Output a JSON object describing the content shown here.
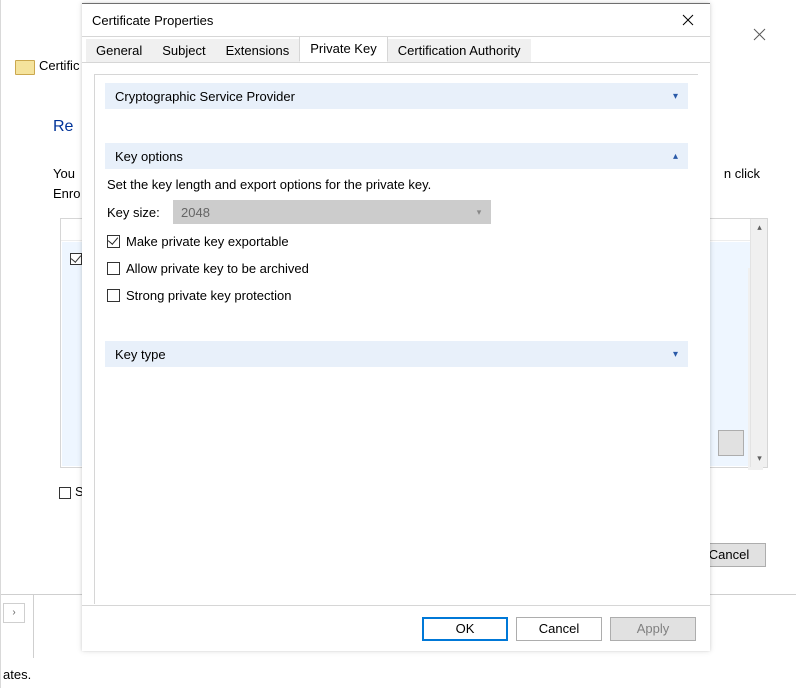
{
  "background": {
    "app_title_fragment": "Certific",
    "heading_fragment": "Re",
    "instruction_line1_fragment": "You",
    "instruction_line2_fragment": "Enro",
    "instruction_right_fragment": "n click",
    "show_checkbox_fragment": "Sh",
    "button_cancel": "Cancel",
    "status_fragment": "ates."
  },
  "dialog": {
    "title": "Certificate Properties",
    "tabs": [
      {
        "label": "General",
        "active": false
      },
      {
        "label": "Subject",
        "active": false
      },
      {
        "label": "Extensions",
        "active": false
      },
      {
        "label": "Private Key",
        "active": true
      },
      {
        "label": "Certification Authority",
        "active": false
      }
    ],
    "sections": {
      "csp": {
        "title": "Cryptographic Service Provider",
        "expanded": false
      },
      "keyoptions": {
        "title": "Key options",
        "expanded": true,
        "description": "Set the key length and export options for the private key.",
        "keysize_label": "Key size:",
        "keysize_value": "2048",
        "checkboxes": [
          {
            "label": "Make private key exportable",
            "checked": true
          },
          {
            "label": "Allow private key to be archived",
            "checked": false
          },
          {
            "label": "Strong private key protection",
            "checked": false
          }
        ]
      },
      "keytype": {
        "title": "Key type",
        "expanded": false
      }
    },
    "buttons": {
      "ok": "OK",
      "cancel": "Cancel",
      "apply": "Apply"
    }
  }
}
